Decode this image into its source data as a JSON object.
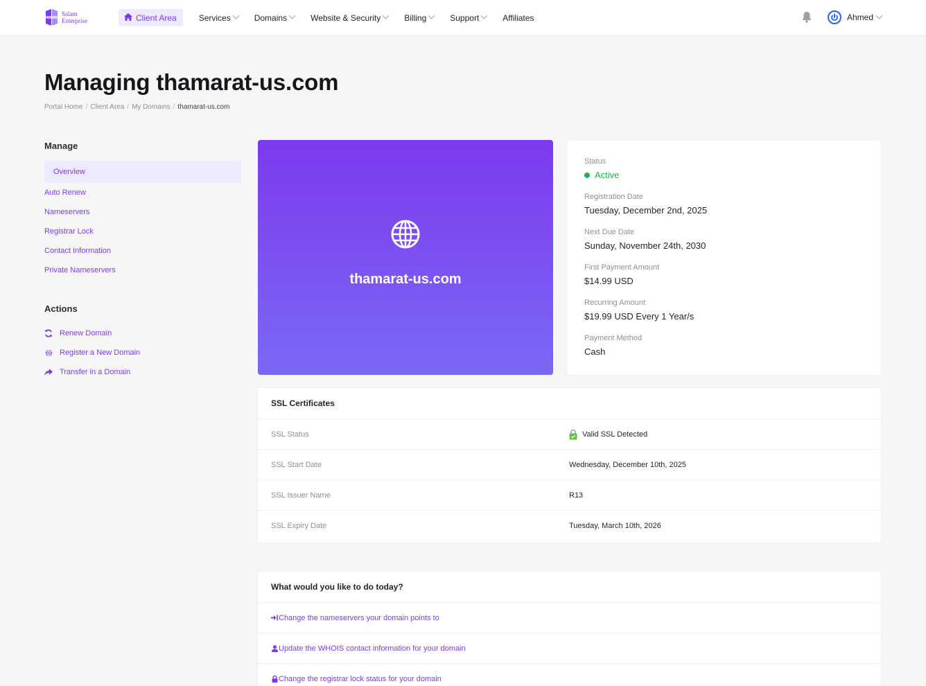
{
  "header": {
    "logo_line1": "Salam",
    "logo_line2": "Enterprise",
    "nav": [
      {
        "label": "Client Area",
        "active": true
      },
      {
        "label": "Services",
        "dropdown": true
      },
      {
        "label": "Domains",
        "dropdown": true
      },
      {
        "label": "Website & Security",
        "dropdown": true
      },
      {
        "label": "Billing",
        "dropdown": true
      },
      {
        "label": "Support",
        "dropdown": true
      },
      {
        "label": "Affiliates",
        "dropdown": false
      }
    ],
    "user_name": "Ahmed"
  },
  "page": {
    "title": "Managing thamarat-us.com",
    "breadcrumb": [
      "Portal Home",
      "Client Area",
      "My Domains",
      "thamarat-us.com"
    ]
  },
  "sidebar": {
    "manage_heading": "Manage",
    "manage_items": [
      {
        "label": "Overview",
        "active": true
      },
      {
        "label": "Auto Renew"
      },
      {
        "label": "Nameservers"
      },
      {
        "label": "Registrar Lock"
      },
      {
        "label": "Contact Information"
      },
      {
        "label": "Private Nameservers"
      }
    ],
    "actions_heading": "Actions",
    "action_items": [
      {
        "label": "Renew Domain",
        "icon": "refresh-icon"
      },
      {
        "label": "Register a New Domain",
        "icon": "globe-icon"
      },
      {
        "label": "Transfer in a Domain",
        "icon": "share-arrow-icon"
      }
    ]
  },
  "hero": {
    "domain": "thamarat-us.com",
    "icon": "globe-icon",
    "gradient_top": "#7c3aed",
    "gradient_bottom": "#7b68f7"
  },
  "info": {
    "status_label": "Status",
    "status_value": "Active",
    "status_color": "#22b04a",
    "registration_label": "Registration Date",
    "registration_value": "Tuesday, December 2nd, 2025",
    "next_due_label": "Next Due Date",
    "next_due_value": "Sunday, November 24th, 2030",
    "first_payment_label": "First Payment Amount",
    "first_payment_value": "$14.99 USD",
    "recurring_label": "Recurring Amount",
    "recurring_value": "$19.99 USD Every 1 Year/s",
    "payment_method_label": "Payment Method",
    "payment_method_value": "Cash"
  },
  "ssl": {
    "heading": "SSL Certificates",
    "rows": [
      {
        "key": "SSL Status",
        "value": "Valid SSL Detected",
        "icon": "ssl-lock-icon"
      },
      {
        "key": "SSL Start Date",
        "value": "Wednesday, December 10th, 2025"
      },
      {
        "key": "SSL Issuer Name",
        "value": "R13"
      },
      {
        "key": "SSL Expiry Date",
        "value": "Tuesday, March 10th, 2026"
      }
    ]
  },
  "todo": {
    "heading": "What would you like to do today?",
    "items": [
      {
        "label": "Change the nameservers your domain points to",
        "icon": "sign-in-icon"
      },
      {
        "label": "Update the WHOIS contact information for your domain",
        "icon": "user-icon"
      },
      {
        "label": "Change the registrar lock status for your domain",
        "icon": "lock-icon"
      }
    ]
  },
  "colors": {
    "accent": "#7c3aed",
    "accent_light": "#ede9fe",
    "active_green": "#22b04a"
  }
}
